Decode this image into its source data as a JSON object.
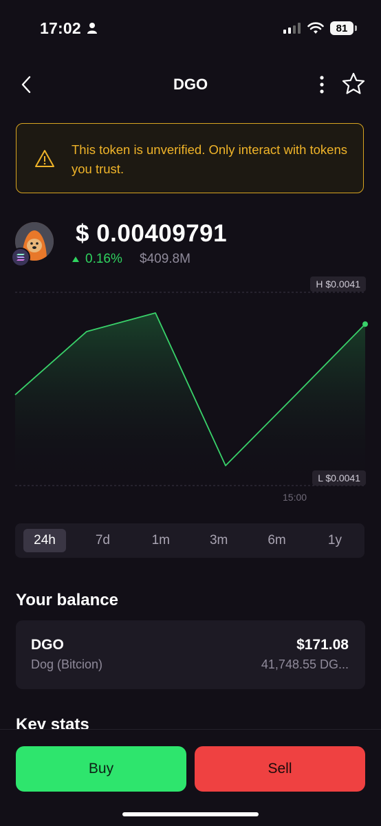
{
  "status_bar": {
    "time": "17:02",
    "battery": "81"
  },
  "header": {
    "title": "DGO"
  },
  "warning": {
    "text": "This token is unverified. Only interact with tokens you trust."
  },
  "token": {
    "price_symbol": "$",
    "price": "0.00409791",
    "change": "0.16%",
    "market_cap": "$409.8M"
  },
  "chart_labels": {
    "high": "H $0.0041",
    "low": "L $0.0041",
    "time_tick": "15:00"
  },
  "chart_data": {
    "type": "area",
    "y": [
      0.0040975,
      0.0040992,
      0.0040997,
      0.0040956,
      0.0040975,
      0.0040994
    ],
    "colors": {
      "line": "#39d26a"
    }
  },
  "ranges": [
    "24h",
    "7d",
    "1m",
    "3m",
    "6m",
    "1y"
  ],
  "active_range": "24h",
  "balance": {
    "heading": "Your balance",
    "symbol": "DGO",
    "name": "Dog (Bitcion)",
    "usd_value": "$171.08",
    "amount": "41,748.55 DG..."
  },
  "key_stats": {
    "heading": "Key stats"
  },
  "actions": {
    "buy": "Buy",
    "sell": "Sell"
  },
  "colors": {
    "background": "#120f17",
    "warning": "#f0b429",
    "positive": "#2fd35f",
    "buy": "#2ee56d",
    "sell": "#ef4141"
  }
}
